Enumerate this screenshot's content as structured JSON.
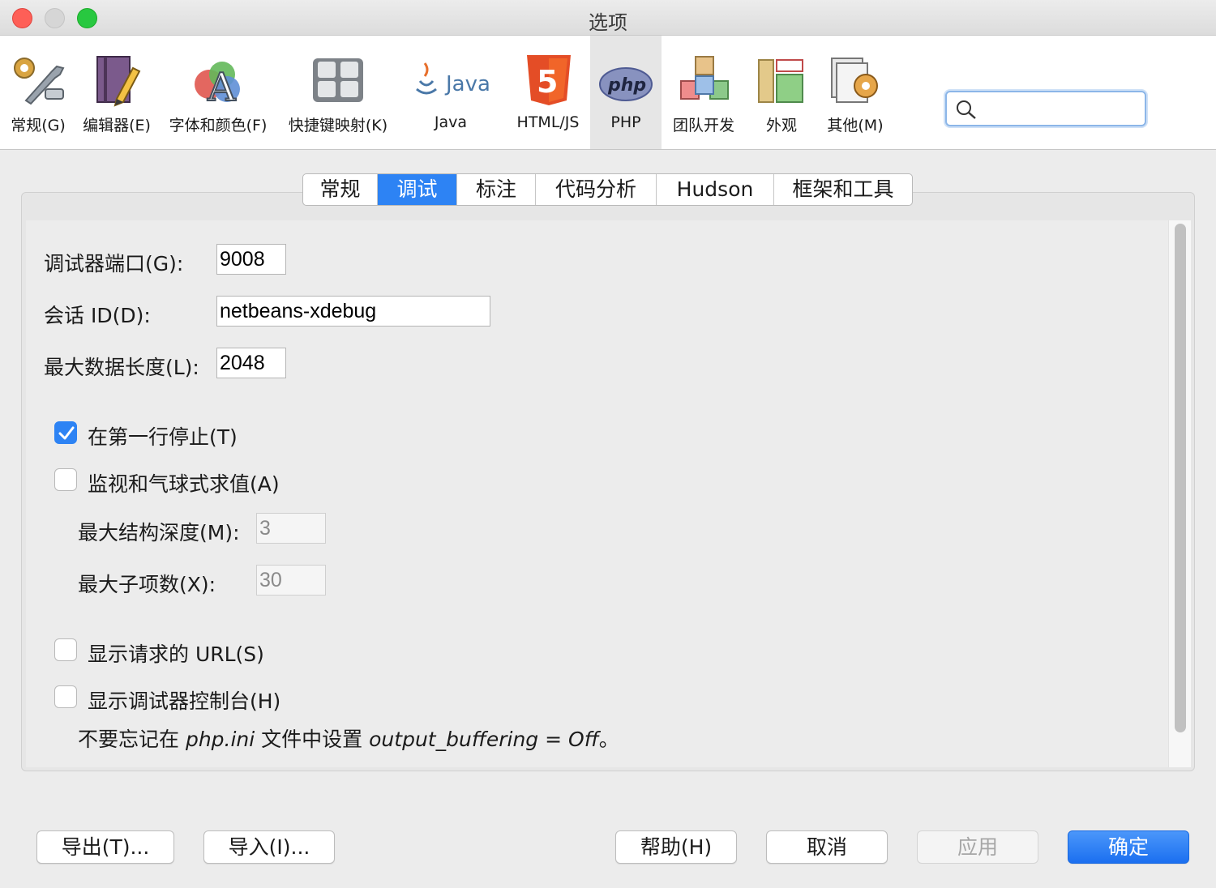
{
  "window": {
    "title": "选项"
  },
  "toolbar": {
    "categories": [
      {
        "label": "常规(G)",
        "icon": "general-wrench-icon"
      },
      {
        "label": "编辑器(E)",
        "icon": "editor-pencil-icon"
      },
      {
        "label": "字体和颜色(F)",
        "icon": "fonts-colors-icon"
      },
      {
        "label": "快捷键映射(K)",
        "icon": "keymap-keyboard-icon"
      },
      {
        "label": "Java",
        "icon": "java-logo-icon"
      },
      {
        "label": "HTML/JS",
        "icon": "html5-logo-icon"
      },
      {
        "label": "PHP",
        "icon": "php-logo-icon",
        "selected": true
      },
      {
        "label": "团队开发",
        "icon": "team-blocks-icon"
      },
      {
        "label": "外观",
        "icon": "appearance-layout-icon"
      },
      {
        "label": "其他(M)",
        "icon": "miscellaneous-icon"
      }
    ],
    "search": {
      "value": "",
      "icon": "search-icon"
    }
  },
  "tabs": [
    {
      "label": "常规"
    },
    {
      "label": "调试",
      "selected": true
    },
    {
      "label": "标注"
    },
    {
      "label": "代码分析"
    },
    {
      "label": "Hudson"
    },
    {
      "label": "框架和工具"
    }
  ],
  "debug": {
    "port": {
      "label": "调试器端口(G):",
      "value": "9008"
    },
    "session_id": {
      "label": "会话 ID(D):",
      "value": "netbeans-xdebug"
    },
    "max_data_length": {
      "label": "最大数据长度(L):",
      "value": "2048"
    },
    "stop_first_line": {
      "label": "在第一行停止(T)",
      "checked": true
    },
    "watch_balloon": {
      "label": "监视和气球式求值(A)",
      "checked": false
    },
    "max_struct_depth": {
      "label": "最大结构深度(M):",
      "value": "3",
      "enabled": false
    },
    "max_children": {
      "label": "最大子项数(X):",
      "value": "30",
      "enabled": false
    },
    "show_url": {
      "label": "显示请求的 URL(S)",
      "checked": false
    },
    "show_console": {
      "label": "显示调试器控制台(H)",
      "checked": false
    },
    "note": {
      "prefix": "不要忘记在 ",
      "file": "php.ini",
      "middle": " 文件中设置 ",
      "setting": "output_buffering = Off",
      "suffix": "。"
    }
  },
  "buttons": {
    "export": "导出(T)...",
    "import": "导入(I)...",
    "help": "帮助(H)",
    "cancel": "取消",
    "apply": "应用",
    "ok": "确定"
  },
  "colors": {
    "accent": "#2d83f4",
    "close": "#fe5f57",
    "maximize": "#28c840"
  }
}
